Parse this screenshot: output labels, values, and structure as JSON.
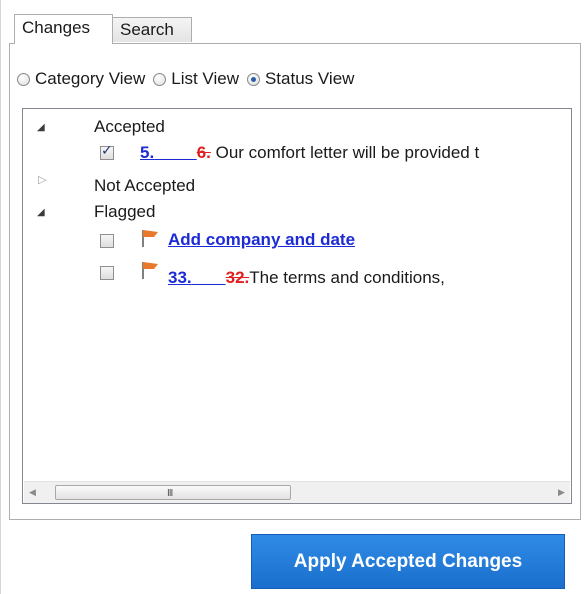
{
  "tabs": [
    {
      "label": "Changes",
      "selected": true
    },
    {
      "label": "Search",
      "selected": false
    }
  ],
  "view_options": [
    {
      "label": "Category View",
      "selected": false
    },
    {
      "label": "List View",
      "selected": false
    },
    {
      "label": "Status View",
      "selected": true
    }
  ],
  "tree": {
    "groups": [
      {
        "label": "Accepted",
        "expanded": true,
        "items": [
          {
            "checked": true,
            "flagged": false,
            "new_num": "5.",
            "old_num": "6.",
            "text": "Our comfort letter will be provided t"
          }
        ]
      },
      {
        "label": "Not Accepted",
        "expanded": false,
        "items": []
      },
      {
        "label": "Flagged",
        "expanded": true,
        "items": [
          {
            "checked": false,
            "flagged": true,
            "link_text": "Add company and date"
          },
          {
            "checked": false,
            "flagged": true,
            "new_num": "33.",
            "old_num": "32.",
            "text": "The terms and conditions,"
          }
        ]
      }
    ]
  },
  "scrollbar": {
    "grip": "III"
  },
  "apply_button": {
    "label": "Apply Accepted Changes"
  },
  "colors": {
    "accent": "#1a6fcc",
    "link": "#1c2bd6",
    "deleted": "#e02020",
    "flag": "#e8782a"
  }
}
